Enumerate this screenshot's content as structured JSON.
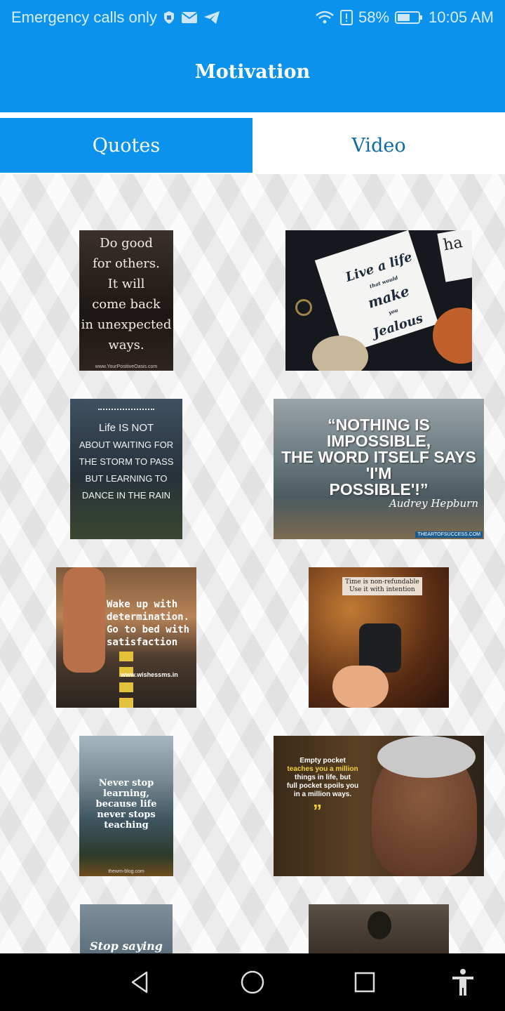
{
  "status_bar": {
    "left_text": "Emergency calls only",
    "battery": "58%",
    "time": "10:05 AM",
    "icons": [
      "shield-icon",
      "mail-icon",
      "telegram-icon",
      "wifi-icon",
      "alert-icon",
      "battery-icon"
    ]
  },
  "app_bar": {
    "title": "Motivation"
  },
  "tabs": [
    {
      "label": "Quotes",
      "active": true
    },
    {
      "label": "Video",
      "active": false
    }
  ],
  "quotes": [
    {
      "lines": [
        "Do good",
        "for others.",
        "It will",
        "come back",
        "in unexpected",
        "ways."
      ],
      "footer": "www.YourPositiveOasis.com"
    },
    {
      "lines": [
        "Live a life",
        "that would",
        "make",
        "you",
        "Jealous"
      ],
      "corner": "ha"
    },
    {
      "lines": [
        "Life IS NOT",
        "ABOUT WAITING FOR",
        "THE STORM TO PASS",
        "BUT LEARNING TO",
        "DANCE IN THE RAIN"
      ]
    },
    {
      "lines": [
        "“NOTHING IS IMPOSSIBLE,",
        "THE WORD ITSELF SAYS 'I'M",
        "POSSIBLE'!”"
      ],
      "author": "Audrey Hepburn",
      "footer": "THEARTOFSUCCESS.COM"
    },
    {
      "lines": [
        "Wake up with",
        "determination.",
        "Go to bed with",
        "satisfaction"
      ],
      "footer": "www.wishessms.in"
    },
    {
      "lines": [
        "Time is non-refundable",
        "Use it with intention"
      ]
    },
    {
      "lines": [
        "Never stop",
        "learning,",
        "because life",
        "never stops",
        "teaching"
      ],
      "footer": "thewm-blog.com"
    },
    {
      "lines": [
        "Empty pocket",
        "teaches you a million",
        "things in life, but",
        "full pocket spoils you",
        "in a million ways."
      ]
    },
    {
      "lines": [
        "Stop saying"
      ]
    },
    {
      "lines": []
    }
  ],
  "colors": {
    "primary": "#0a92ec",
    "tab_inactive_text": "#0d6aa5",
    "nav_bar": "#000000"
  },
  "nav_bar": {
    "icons": [
      "back-icon",
      "home-icon",
      "recents-icon",
      "accessibility-icon"
    ]
  }
}
